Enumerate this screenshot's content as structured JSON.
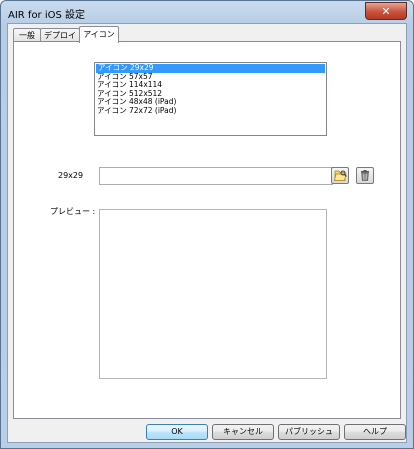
{
  "window": {
    "title": "AIR for iOS 設定",
    "close_symbol": "✕"
  },
  "tabs": [
    {
      "label": "一般",
      "active": false
    },
    {
      "label": "デプロイ",
      "active": false
    },
    {
      "label": "アイコン",
      "active": true
    }
  ],
  "icon_list": {
    "items": [
      "アイコン 29x29",
      "アイコン 57x57",
      "アイコン 114x114",
      "アイコン 512x512",
      "アイコン 48x48 (iPad)",
      "アイコン 72x72 (iPad)"
    ],
    "selected_index": 0
  },
  "icon_file": {
    "label": "29x29",
    "value": "",
    "browse_icon": "folder-browse-icon",
    "delete_icon": "trash-icon"
  },
  "preview": {
    "label": "プレビュー :"
  },
  "buttons": {
    "ok": "OK",
    "cancel": "キャンセル",
    "publish": "パブリッシュ",
    "help": "ヘルプ"
  }
}
